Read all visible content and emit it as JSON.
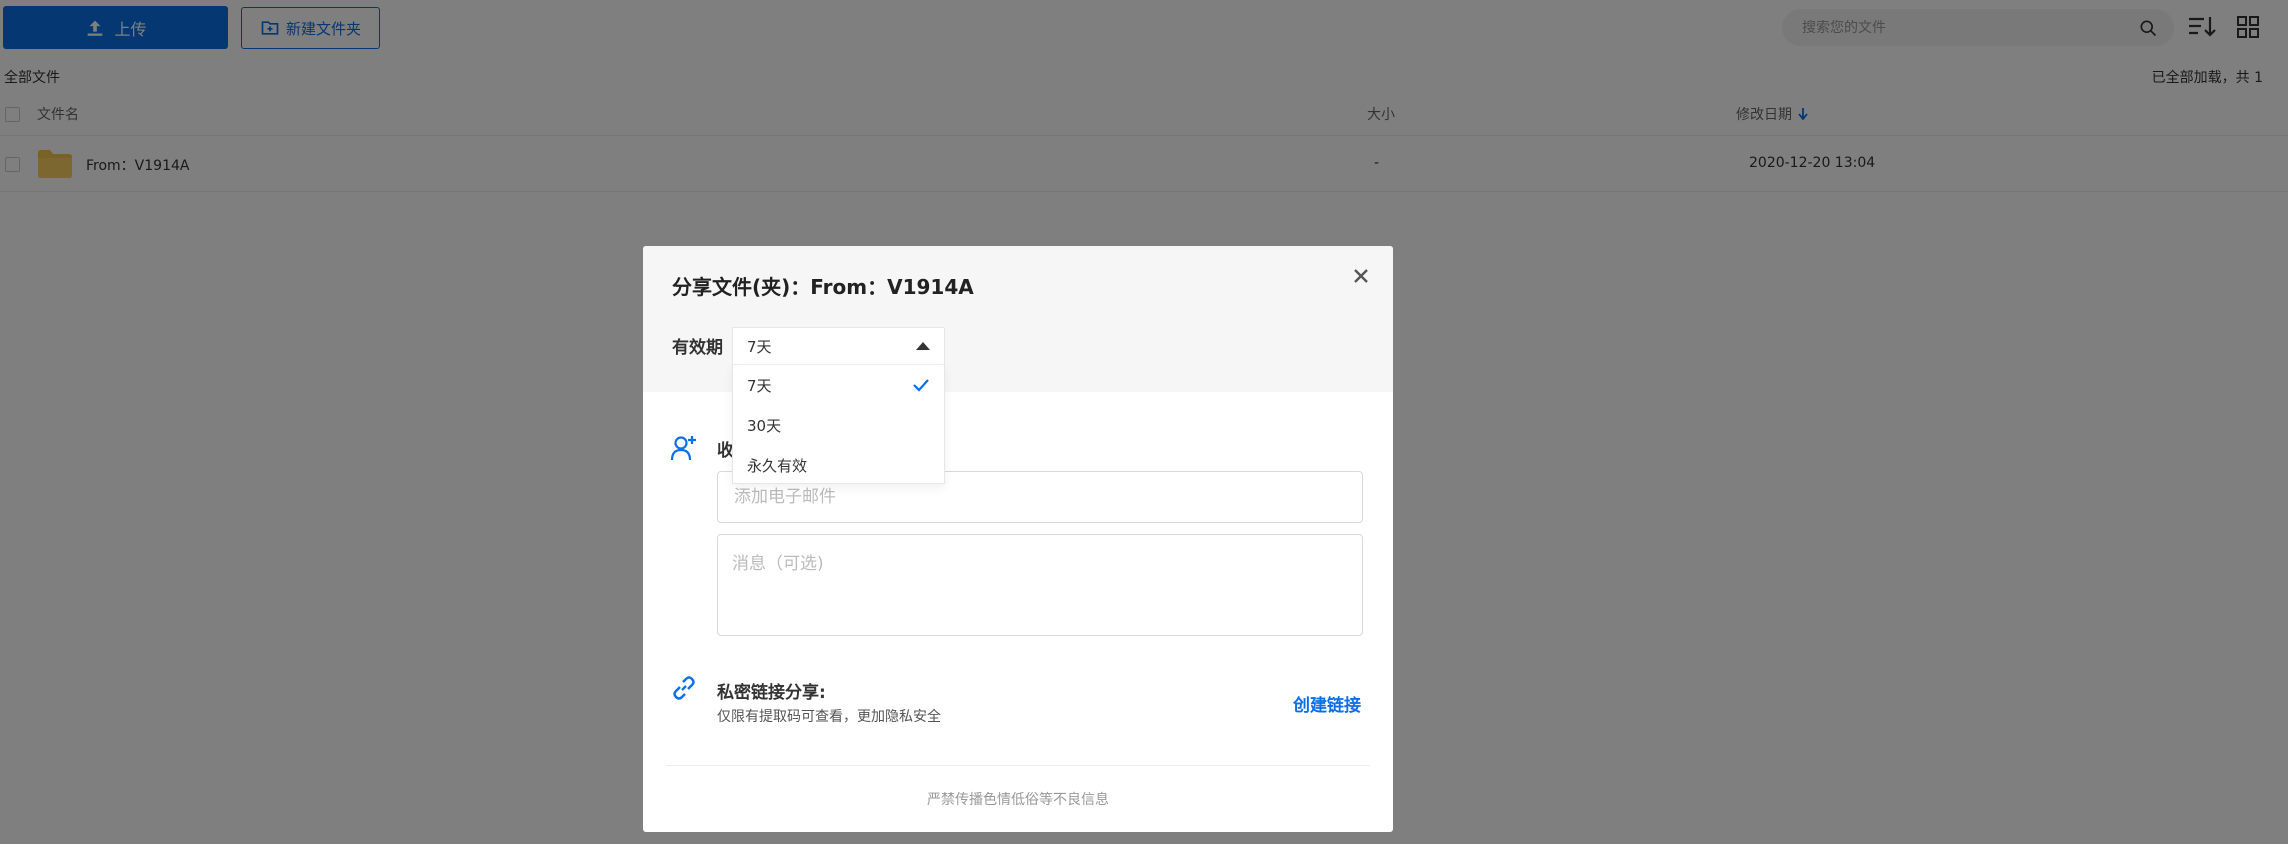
{
  "toolbar": {
    "upload_label": "上传",
    "new_folder_label": "新建文件夹",
    "search_placeholder": "搜索您的文件",
    "accent_color": "#0b6fe6"
  },
  "breadcrumb": "全部文件",
  "loaded_info": "已全部加载，共 1",
  "table": {
    "headers": {
      "name": "文件名",
      "size": "大小",
      "modified": "修改日期"
    },
    "rows": [
      {
        "name": "From：V1914A",
        "size": "-",
        "modified": "2020-12-20 13:04",
        "icon": "folder-icon"
      }
    ]
  },
  "dialog": {
    "title": "分享文件(夹)：From：V1914A",
    "validity_label": "有效期",
    "validity_selected": "7天",
    "validity_options": [
      "7天",
      "30天",
      "永久有效"
    ],
    "recipient_label": "收",
    "email_placeholder": "添加电子邮件",
    "message_placeholder": "消息（可选)",
    "private_title": "私密链接分享:",
    "private_desc": "仅限有提取码可查看，更加隐私安全",
    "create_link": "创建链接",
    "footer_note": "严禁传播色情低俗等不良信息"
  }
}
